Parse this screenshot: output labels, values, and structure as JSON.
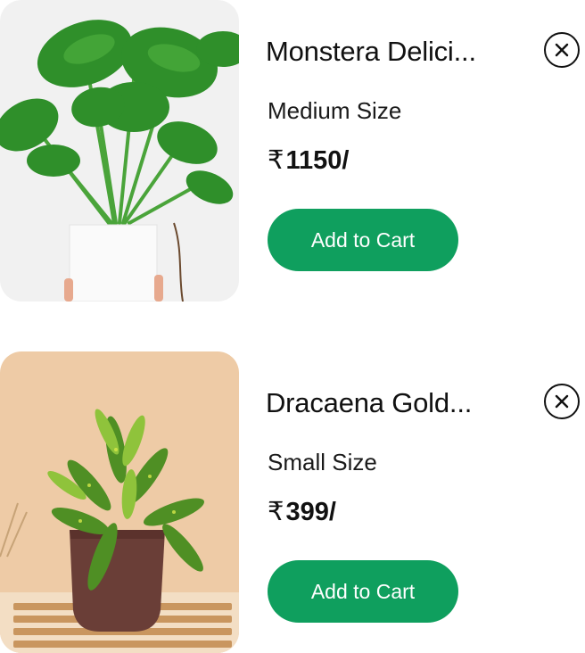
{
  "cart_items": [
    {
      "name": "Monstera Delici...",
      "size": "Medium Size",
      "currency_symbol": "₹",
      "price": "1150/",
      "add_to_cart_label": "Add to Cart",
      "close_icon": "close-icon",
      "image": "monstera-plant-photo"
    },
    {
      "name": "Dracaena Gold...",
      "size": "Small Size",
      "currency_symbol": "₹",
      "price": "399/",
      "add_to_cart_label": "Add to Cart",
      "close_icon": "close-icon",
      "image": "dracaena-plant-photo"
    }
  ],
  "colors": {
    "accent": "#0f9f5e",
    "text": "#111111",
    "card_bg_beige": "#eecba6"
  }
}
